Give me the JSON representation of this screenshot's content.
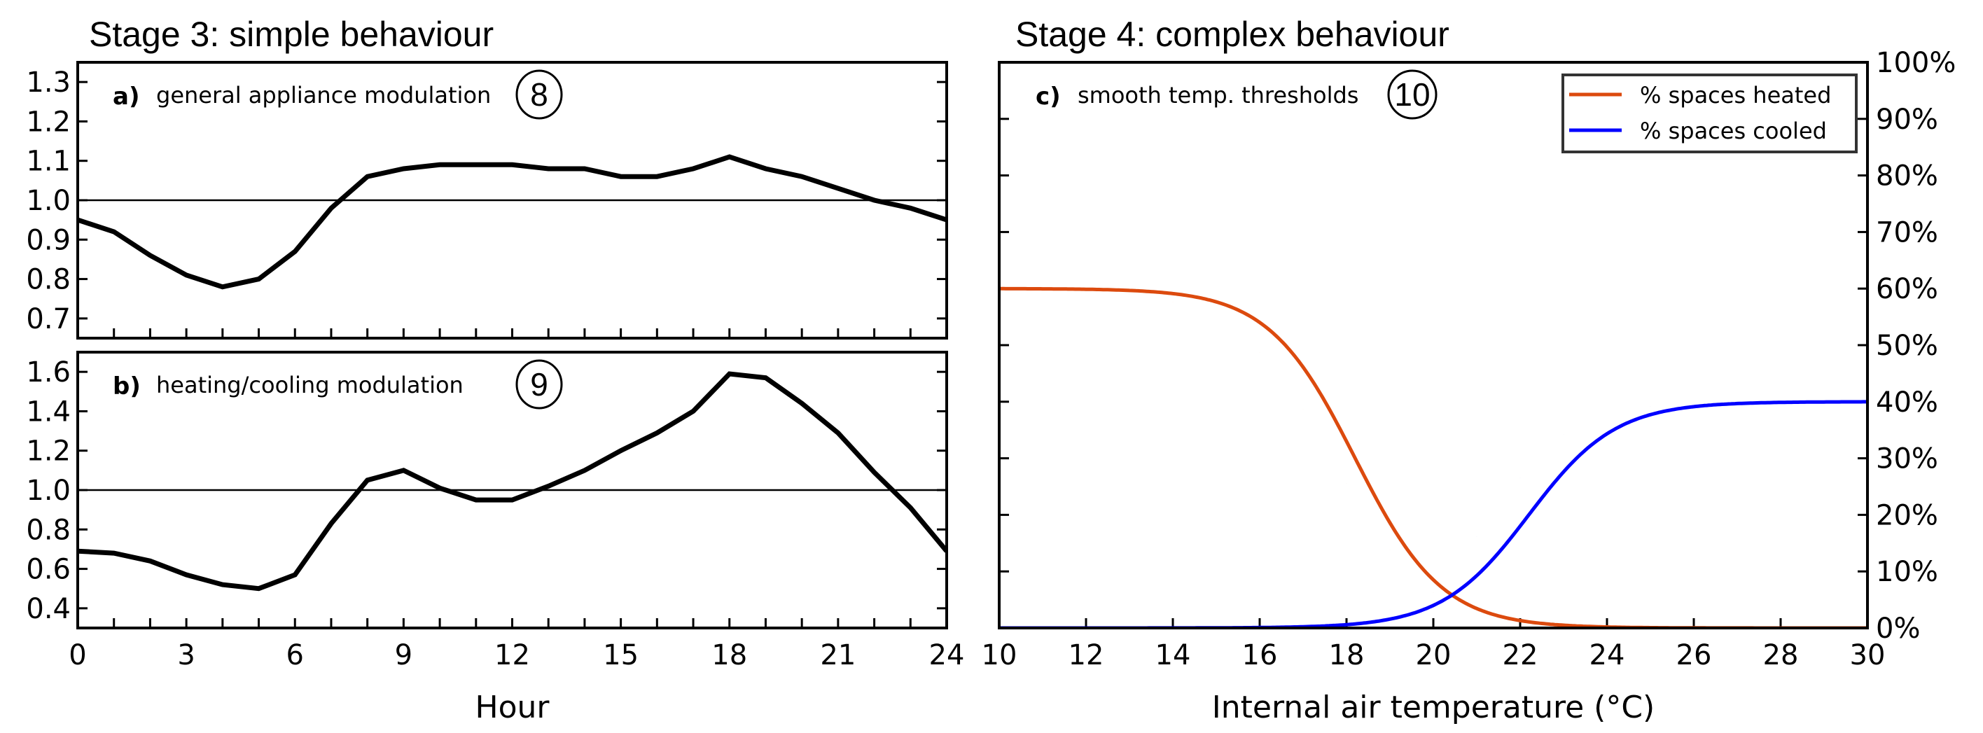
{
  "titles": {
    "left": "Stage 3: simple behaviour",
    "right": "Stage 4: complex behaviour"
  },
  "chart_data": [
    {
      "id": "a",
      "type": "line",
      "panel_letter": "a)",
      "panel_text": "general appliance modulation",
      "marker_number": "8",
      "x": [
        0,
        1,
        2,
        3,
        4,
        5,
        6,
        7,
        8,
        9,
        10,
        11,
        12,
        13,
        14,
        15,
        16,
        17,
        18,
        19,
        20,
        21,
        22,
        23,
        24
      ],
      "series": [
        {
          "name": "general appliance modulation",
          "color": "#000000",
          "values": [
            0.95,
            0.92,
            0.86,
            0.81,
            0.78,
            0.8,
            0.87,
            0.98,
            1.06,
            1.08,
            1.09,
            1.09,
            1.09,
            1.08,
            1.08,
            1.06,
            1.06,
            1.08,
            1.11,
            1.08,
            1.06,
            1.03,
            1.0,
            0.98,
            0.95
          ]
        }
      ],
      "reference_line": 1.0,
      "xlim": [
        0,
        24
      ],
      "ylim": [
        0.65,
        1.35
      ],
      "yticks": [
        0.7,
        0.8,
        0.9,
        1.0,
        1.1,
        1.2,
        1.3
      ],
      "ytick_labels": [
        "0.7",
        "0.8",
        "0.9",
        "1.0",
        "1.1",
        "1.2",
        "1.3"
      ],
      "xticks_minor": [
        1,
        2,
        3,
        4,
        5,
        6,
        7,
        8,
        9,
        10,
        11,
        12,
        13,
        14,
        15,
        16,
        17,
        18,
        19,
        20,
        21,
        22,
        23
      ],
      "xlabel": "",
      "ylabel": ""
    },
    {
      "id": "b",
      "type": "line",
      "panel_letter": "b)",
      "panel_text": "heating/cooling modulation",
      "marker_number": "9",
      "x": [
        0,
        1,
        2,
        3,
        4,
        5,
        6,
        7,
        8,
        9,
        10,
        11,
        12,
        13,
        14,
        15,
        16,
        17,
        18,
        19,
        20,
        21,
        22,
        23,
        24
      ],
      "series": [
        {
          "name": "heating/cooling modulation",
          "color": "#000000",
          "values": [
            0.69,
            0.68,
            0.64,
            0.57,
            0.52,
            0.5,
            0.57,
            0.83,
            1.05,
            1.1,
            1.01,
            0.95,
            0.95,
            1.02,
            1.1,
            1.2,
            1.29,
            1.4,
            1.59,
            1.57,
            1.44,
            1.29,
            1.09,
            0.91,
            0.69
          ]
        }
      ],
      "reference_line": 1.0,
      "xlim": [
        0,
        24
      ],
      "ylim": [
        0.3,
        1.7
      ],
      "yticks": [
        0.4,
        0.6,
        0.8,
        1.0,
        1.2,
        1.4,
        1.6
      ],
      "ytick_labels": [
        "0.4",
        "0.6",
        "0.8",
        "1.0",
        "1.2",
        "1.4",
        "1.6"
      ],
      "xticks": [
        0,
        3,
        6,
        9,
        12,
        15,
        18,
        21,
        24
      ],
      "xtick_labels": [
        "0",
        "3",
        "6",
        "9",
        "12",
        "15",
        "18",
        "21",
        "24"
      ],
      "xticks_minor": [
        1,
        2,
        3,
        4,
        5,
        6,
        7,
        8,
        9,
        10,
        11,
        12,
        13,
        14,
        15,
        16,
        17,
        18,
        19,
        20,
        21,
        22,
        23
      ],
      "xlabel": "Hour",
      "ylabel": ""
    },
    {
      "id": "c",
      "type": "line",
      "panel_letter": "c)",
      "panel_text": "smooth temp. thresholds",
      "marker_number": "10",
      "x": [
        10,
        11,
        12,
        13,
        14,
        15,
        16,
        17,
        18,
        19,
        20,
        21,
        22,
        23,
        24,
        25,
        26,
        27,
        28,
        29,
        30
      ],
      "series": [
        {
          "name": "% spaces heated",
          "color": "#DC4A0E",
          "values": [
            59.9,
            59.8,
            59.6,
            59.0,
            57.6,
            54.6,
            48.7,
            38.7,
            25.6,
            13.8,
            6.2,
            2.5,
            0.9,
            0.4,
            0.1,
            0.05,
            0.02,
            0.01,
            0.0,
            0.0,
            0.0
          ]
        },
        {
          "name": "% spaces cooled",
          "color": "#0000FF",
          "values": [
            0.0,
            0.0,
            0.0,
            0.0,
            0.02,
            0.05,
            0.2,
            0.5,
            1.3,
            3.3,
            7.8,
            16.2,
            26.5,
            34.2,
            37.8,
            39.2,
            39.7,
            39.9,
            40.0,
            40.0,
            40.0
          ]
        }
      ],
      "logistic_fit": {
        "heated": {
          "max": 60,
          "midpoint": 18.2,
          "k": 1.0
        },
        "cooled": {
          "max": 40,
          "midpoint": 22.2,
          "k": 1.0
        }
      },
      "xlim": [
        10,
        30
      ],
      "ylim": [
        0,
        100
      ],
      "yticks": [
        0,
        10,
        20,
        30,
        40,
        50,
        60,
        70,
        80,
        90,
        100
      ],
      "ytick_labels": [
        "0%",
        "10%",
        "20%",
        "30%",
        "40%",
        "50%",
        "60%",
        "70%",
        "80%",
        "90%",
        "100%"
      ],
      "xticks": [
        10,
        12,
        14,
        16,
        18,
        20,
        22,
        24,
        26,
        28,
        30
      ],
      "xtick_labels": [
        "10",
        "12",
        "14",
        "16",
        "18",
        "20",
        "22",
        "24",
        "26",
        "28",
        "30"
      ],
      "xlabel": "Internal air temperature (°C)",
      "ylabel": "",
      "y_axis_side": "right",
      "legend": {
        "placement": "top-right",
        "entries": [
          "% spaces heated",
          "% spaces cooled"
        ]
      }
    }
  ]
}
